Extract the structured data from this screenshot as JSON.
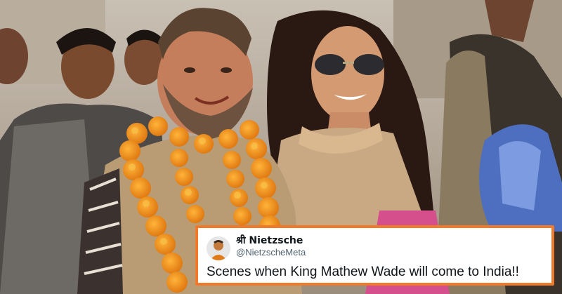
{
  "tweet": {
    "display_name": "श्री Nietzsche",
    "handle": "@NietzscheMeta",
    "text": "Scenes when  King Mathew Wade will come to India!!",
    "avatar_icon": "profile-avatar-icon",
    "border_color": "#f07a2b"
  }
}
